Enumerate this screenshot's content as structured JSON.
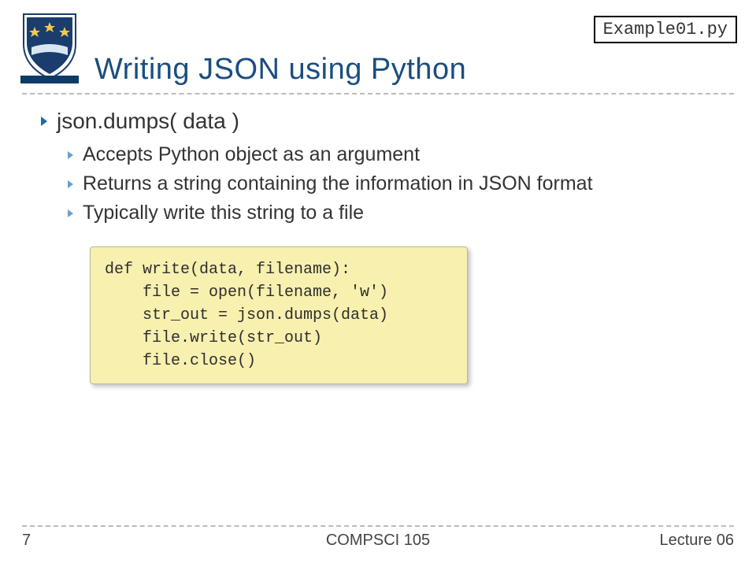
{
  "header": {
    "title": "Writing JSON using Python",
    "file_tag": "Example01.py"
  },
  "bullets": {
    "b1": "json.dumps( data )",
    "sub": [
      "Accepts Python object as an argument",
      "Returns a string containing the information in JSON format",
      "Typically write this string to a file"
    ]
  },
  "code": "def write(data, filename):\n    file = open(filename, 'w')\n    str_out = json.dumps(data)\n    file.write(str_out)\n    file.close()",
  "footer": {
    "page": "7",
    "course": "COMPSCI 105",
    "lecture": "Lecture 06"
  }
}
